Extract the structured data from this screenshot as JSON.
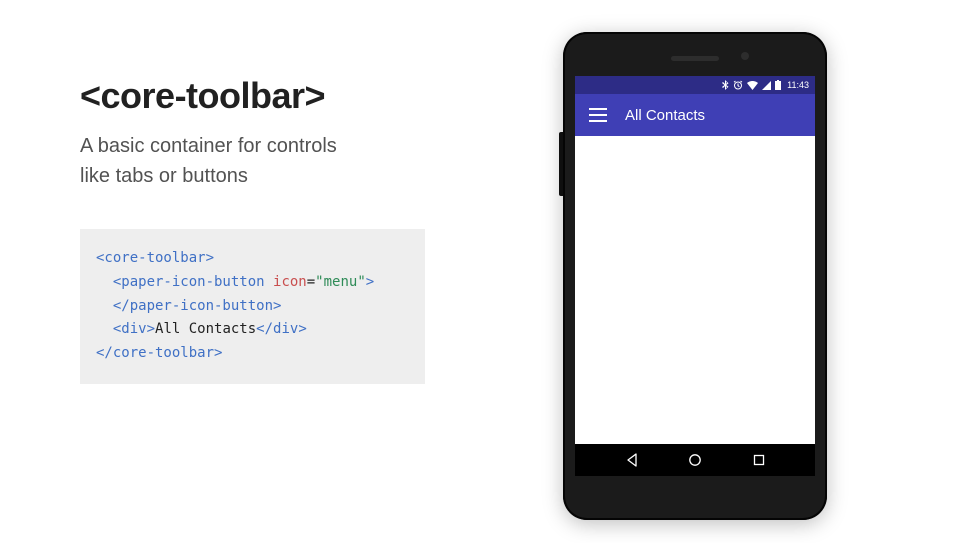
{
  "slide": {
    "title": "<core-toolbar>",
    "subtitle_line1": "A basic container for controls",
    "subtitle_line2": "like tabs or buttons"
  },
  "code": {
    "open_core": "<core-toolbar>",
    "paper_open_tag": "<paper-icon-button",
    "paper_attr_name": "icon",
    "paper_attr_eq": "=",
    "paper_attr_val": "\"menu\"",
    "paper_open_close": ">",
    "paper_close": "</paper-icon-button>",
    "div_open": "<div>",
    "div_text": "All Contacts",
    "div_close": "</div>",
    "close_core": "</core-toolbar>"
  },
  "phone": {
    "status_time": "11:43",
    "toolbar_title": "All Contacts"
  }
}
